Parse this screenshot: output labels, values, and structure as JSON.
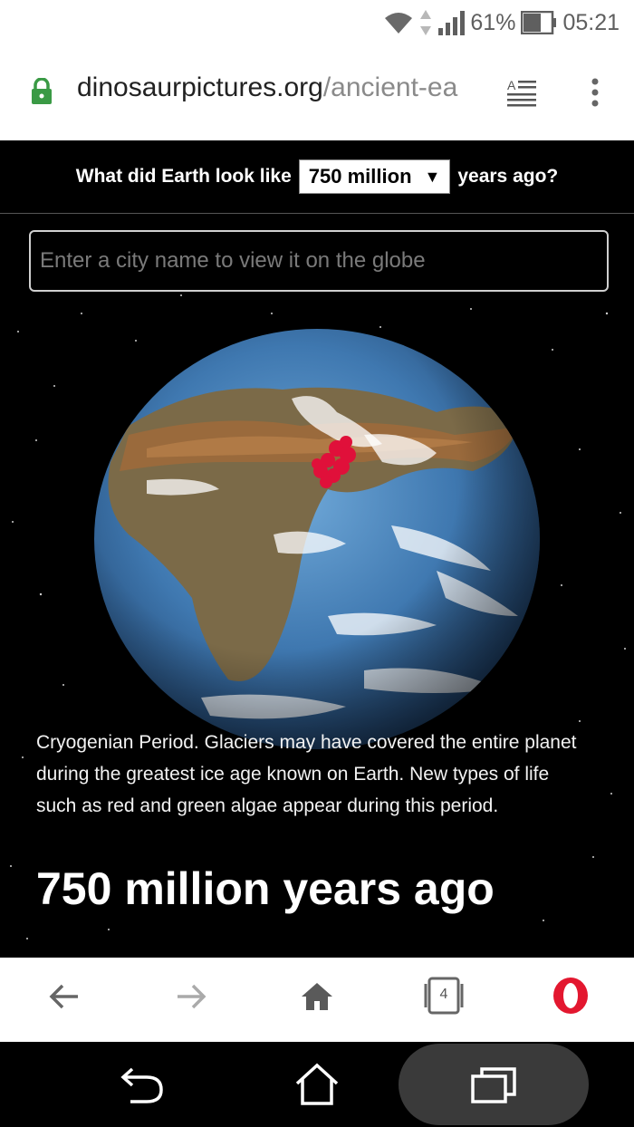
{
  "status_bar": {
    "battery": "61%",
    "time": "05:21"
  },
  "browser": {
    "url_domain": "dinosaurpictures.org",
    "url_path": "/ancient-ea"
  },
  "page": {
    "question_prefix": "What did Earth look like",
    "selected_era": "750 million",
    "question_suffix": "years ago?",
    "search_placeholder": "Enter a city name to view it on the globe",
    "description": "Cryogenian Period. Glaciers may have covered the entire planet during the greatest ice age known on Earth. New types of life such as red and green algae appear during this period.",
    "heading": "750 million years ago"
  },
  "browser_nav": {
    "tab_count": "4"
  },
  "colors": {
    "accent_red": "#e0103a",
    "lock_green": "#3a9a45",
    "opera_red": "#e3172f"
  }
}
